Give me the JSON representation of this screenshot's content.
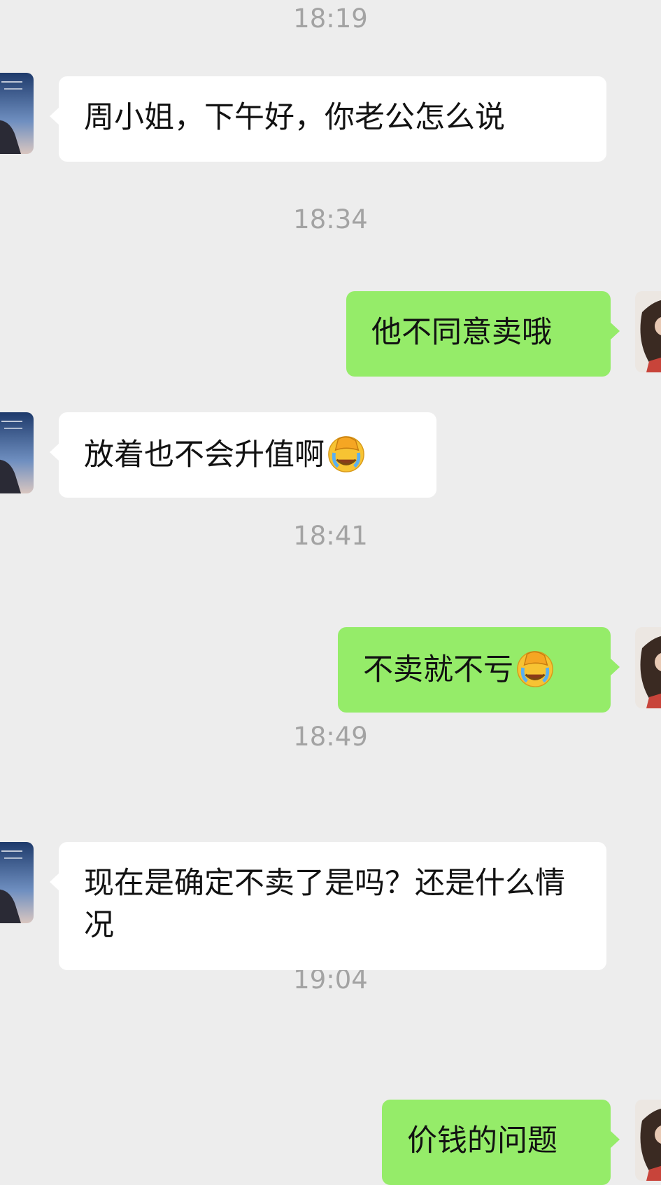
{
  "colors": {
    "background": "#ededed",
    "incoming_bubble": "#ffffff",
    "outgoing_bubble": "#95ec69",
    "timestamp_text": "#a3a3a3"
  },
  "messages": [
    {
      "time": "18:19",
      "direction": "incoming",
      "text": "周小姐，下午好，你老公怎么说"
    },
    {
      "time": "18:34",
      "direction": "outgoing",
      "text": "他不同意卖哦"
    },
    {
      "direction": "incoming",
      "text": "放着也不会升值啊",
      "emoji": "face-palm-crying-emoji"
    },
    {
      "time": "18:41",
      "direction": "outgoing",
      "text": "不卖就不亏",
      "emoji": "face-palm-crying-emoji"
    },
    {
      "time": "18:49",
      "direction": "incoming",
      "text": "现在是确定不卖了是吗？还是什么情况"
    },
    {
      "time": "19:04",
      "direction": "outgoing",
      "text": "价钱的问题"
    }
  ]
}
